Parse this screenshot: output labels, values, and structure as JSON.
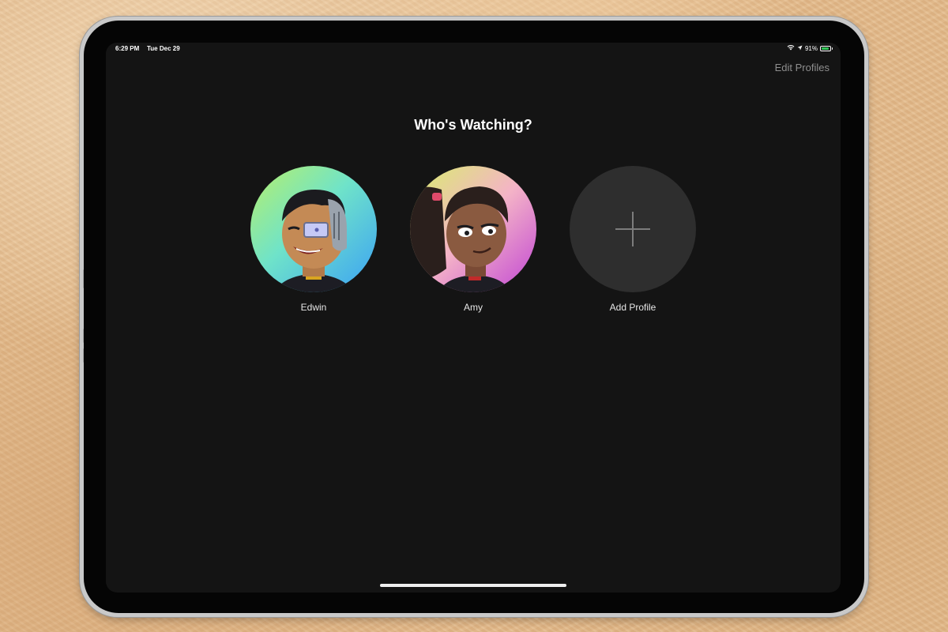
{
  "status_bar": {
    "time": "6:29 PM",
    "date": "Tue Dec 29",
    "battery": "91%",
    "battery_level": 0.91
  },
  "header": {
    "edit_profiles_label": "Edit Profiles"
  },
  "main": {
    "title": "Who's Watching?",
    "profiles": [
      {
        "name": "Edwin"
      },
      {
        "name": "Amy"
      }
    ],
    "add_profile_label": "Add Profile"
  },
  "colors": {
    "screen_background": "#141414",
    "add_circle": "#2e2e2e",
    "battery_fill": "#34c759"
  },
  "icons": {
    "wifi": "wifi-icon",
    "location": "location-arrow-icon",
    "battery": "battery-icon",
    "add": "plus-icon"
  }
}
